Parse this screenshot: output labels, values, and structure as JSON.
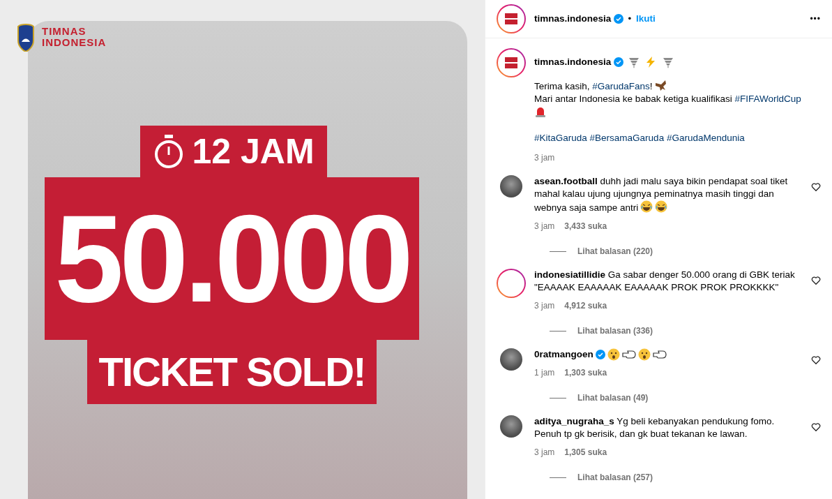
{
  "poster": {
    "logo_lines": [
      "TIMNAS",
      "INDONESIA"
    ],
    "timer": "12 JAM",
    "count": "50.000",
    "headline": "TICKET SOLD!"
  },
  "header": {
    "username": "timnas.indonesia",
    "verified": true,
    "separator": "•",
    "follow": "Ikuti",
    "more": "•••"
  },
  "caption": {
    "username": "timnas.indonesia",
    "verified": true,
    "icons": [
      {
        "kind": "tornado"
      },
      {
        "kind": "lightning"
      },
      {
        "kind": "tornado"
      }
    ],
    "lines": [
      {
        "segments": [
          {
            "kind": "plain",
            "text": "Terima kasih, "
          },
          {
            "kind": "hashtag",
            "text": "#GarudaFans"
          },
          {
            "kind": "plain",
            "text": "!"
          }
        ],
        "icons": [
          {
            "kind": "eagle"
          }
        ]
      },
      {
        "segments": [
          {
            "kind": "plain",
            "text": "Mari antar Indonesia ke babak ketiga kualifikasi "
          },
          {
            "kind": "hashtag",
            "text": "#FIFAWorldCup"
          }
        ],
        "icons": [
          {
            "kind": "siren"
          }
        ]
      },
      {
        "segments": [
          {
            "kind": "hashtag",
            "text": "#KitaGaruda"
          },
          {
            "kind": "hashtag",
            "text": "#BersamaGaruda"
          },
          {
            "kind": "hashtag",
            "text": "#GarudaMendunia"
          }
        ]
      }
    ],
    "time": "3 jam"
  },
  "comments": [
    {
      "username": "asean.football",
      "verified": false,
      "story_ring": false,
      "text": "duhh jadi malu saya bikin pendapat soal tiket mahal kalau ujung ujungnya peminatnya masih tinggi dan webnya saja sampe antri",
      "icons": [
        {
          "kind": "laughing"
        },
        {
          "kind": "laughing"
        }
      ],
      "time": "3 jam",
      "likes": "3,433 suka",
      "replies": "Lihat balasan (220)"
    },
    {
      "username": "indonesiatillidie",
      "verified": false,
      "story_ring": true,
      "text": "Ga sabar denger 50.000 orang di GBK teriak \"EAAAAK EAAAAAK EAAAAAK PROK PROK PROKKKK\"",
      "time": "3 jam",
      "likes": "4,912 suka",
      "replies": "Lihat balasan (336)"
    },
    {
      "username": "0ratmangoen",
      "verified": true,
      "story_ring": false,
      "icons": [
        {
          "kind": "surprised"
        },
        {
          "kind": "pointing"
        },
        {
          "kind": "surprised"
        },
        {
          "kind": "pointing"
        }
      ],
      "time": "1 jam",
      "likes": "1,303 suka",
      "replies": "Lihat balasan (49)"
    },
    {
      "username": "aditya_nugraha_s",
      "verified": false,
      "story_ring": false,
      "text": "Yg beli kebanyakan pendukung fomo. Penuh tp gk berisik, dan gk buat tekanan ke lawan.",
      "time": "3 jam",
      "likes": "1,305 suka",
      "replies": "Lihat balasan (257)"
    }
  ]
}
